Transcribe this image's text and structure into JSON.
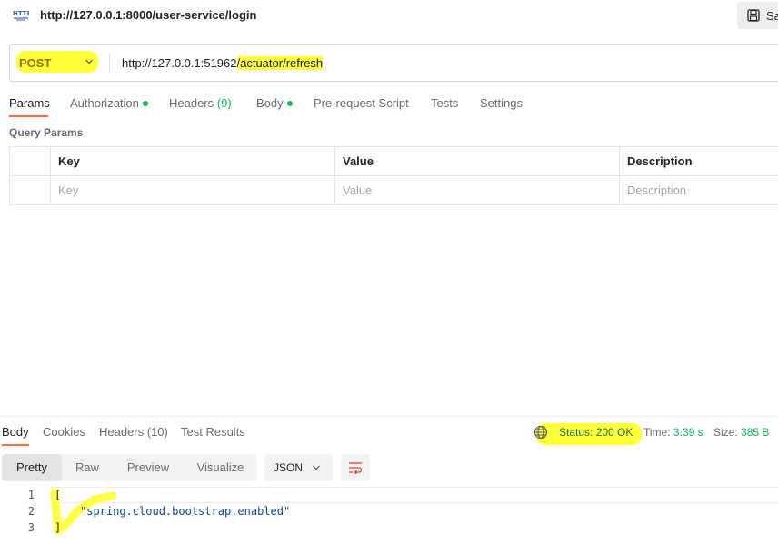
{
  "header": {
    "icon": "http-icon",
    "title": "http://127.0.0.1:8000/user-service/login",
    "save_label": "Sa"
  },
  "request": {
    "method": "POST",
    "url_base": "http://127.0.0.1:51962",
    "url_path": "/actuator/refresh"
  },
  "request_tabs": {
    "params": "Params",
    "authorization": "Authorization",
    "headers": "Headers",
    "headers_count": "(9)",
    "body": "Body",
    "pre_request": "Pre-request Script",
    "tests": "Tests",
    "settings": "Settings"
  },
  "query_params": {
    "title": "Query Params",
    "columns": [
      "Key",
      "Value",
      "Description"
    ],
    "placeholders": [
      "Key",
      "Value",
      "Description"
    ]
  },
  "response_tabs": {
    "body": "Body",
    "cookies": "Cookies",
    "headers": "Headers (10)",
    "test_results": "Test Results"
  },
  "response_meta": {
    "status": "Status: 200 OK",
    "time_label": "Time:",
    "time_value": "3.39 s",
    "size_label": "Size:",
    "size_value": "385 B"
  },
  "view_modes": [
    "Pretty",
    "Raw",
    "Preview",
    "Visualize"
  ],
  "format": "JSON",
  "code": {
    "line_numbers": [
      "1",
      "2",
      "3"
    ],
    "line1": "[",
    "line2": "\"spring.cloud.bootstrap.enabled\"",
    "line3": "]"
  },
  "colors": {
    "accent": "#ff6c37",
    "highlight": "#ffff3a",
    "success": "#0cbb52"
  }
}
